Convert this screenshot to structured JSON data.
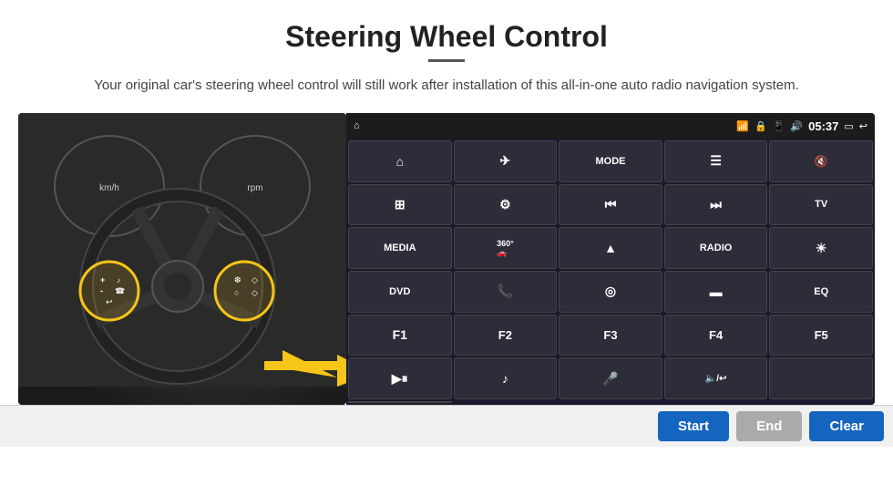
{
  "header": {
    "title": "Steering Wheel Control",
    "subtitle": "Your original car's steering wheel control will still work after installation of this all-in-one auto radio navigation system."
  },
  "status_bar": {
    "time": "05:37",
    "icons": [
      "wifi",
      "lock",
      "sim",
      "bluetooth",
      "screen",
      "back"
    ]
  },
  "button_grid": [
    {
      "id": "r1c1",
      "label": "⌂",
      "type": "icon"
    },
    {
      "id": "r1c2",
      "label": "✈",
      "type": "icon"
    },
    {
      "id": "r1c3",
      "label": "MODE",
      "type": "text"
    },
    {
      "id": "r1c4",
      "label": "☰",
      "type": "icon"
    },
    {
      "id": "r1c5",
      "label": "🔇",
      "type": "icon"
    },
    {
      "id": "r1c6",
      "label": "⊞",
      "type": "icon"
    },
    {
      "id": "r2c1",
      "label": "⊙",
      "type": "icon"
    },
    {
      "id": "r2c2",
      "label": "⏮",
      "type": "icon"
    },
    {
      "id": "r2c3",
      "label": "⏭",
      "type": "icon"
    },
    {
      "id": "r2c4",
      "label": "TV",
      "type": "text"
    },
    {
      "id": "r2c5",
      "label": "MEDIA",
      "type": "text"
    },
    {
      "id": "r3c1",
      "label": "360°",
      "type": "text"
    },
    {
      "id": "r3c2",
      "label": "▲",
      "type": "icon"
    },
    {
      "id": "r3c3",
      "label": "RADIO",
      "type": "text"
    },
    {
      "id": "r3c4",
      "label": "☀",
      "type": "icon"
    },
    {
      "id": "r3c5",
      "label": "DVD",
      "type": "text"
    },
    {
      "id": "r4c1",
      "label": "☎",
      "type": "icon"
    },
    {
      "id": "r4c2",
      "label": "◎",
      "type": "icon"
    },
    {
      "id": "r4c3",
      "label": "▬",
      "type": "icon"
    },
    {
      "id": "r4c4",
      "label": "EQ",
      "type": "text"
    },
    {
      "id": "r4c5",
      "label": "F1",
      "type": "text"
    },
    {
      "id": "r5c1",
      "label": "F2",
      "type": "text"
    },
    {
      "id": "r5c2",
      "label": "F3",
      "type": "text"
    },
    {
      "id": "r5c3",
      "label": "F4",
      "type": "text"
    },
    {
      "id": "r5c4",
      "label": "F5",
      "type": "text"
    },
    {
      "id": "r5c5",
      "label": "▶⏸",
      "type": "icon"
    },
    {
      "id": "r6c1",
      "label": "♪",
      "type": "icon"
    },
    {
      "id": "r6c2",
      "label": "🎤",
      "type": "icon"
    },
    {
      "id": "r6c3",
      "label": "🔈/↩",
      "type": "icon"
    },
    {
      "id": "r6c4",
      "label": "",
      "type": "empty"
    },
    {
      "id": "r6c5",
      "label": "",
      "type": "empty"
    }
  ],
  "bottom_buttons": {
    "start": "Start",
    "end": "End",
    "clear": "Clear"
  }
}
